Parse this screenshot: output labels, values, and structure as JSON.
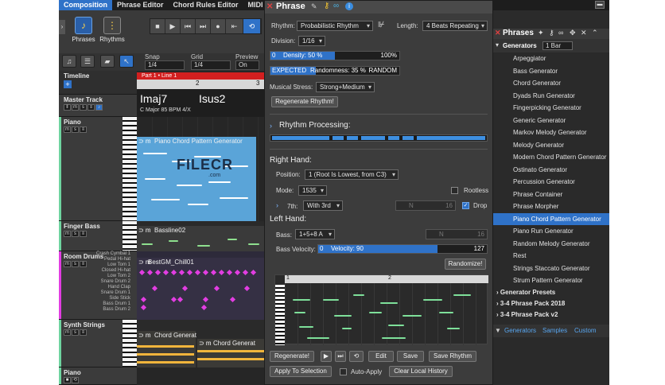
{
  "menubar": {
    "tabs": [
      "Composition",
      "Phrase Editor",
      "Chord Rules Editor",
      "MIDI Import"
    ]
  },
  "toolbar": {
    "phrases_label": "Phrases",
    "rhythms_label": "Rhythms"
  },
  "snaprow": {
    "snap_label": "Snap",
    "snap_value": "1/4",
    "grid_label": "Grid",
    "grid_value": "1/4",
    "preview_label": "Preview",
    "preview_value": "On"
  },
  "timeline": {
    "label": "Timeline",
    "marker": "Part 1 • Line 1",
    "bar2": "2",
    "bar3": "3"
  },
  "chords": {
    "c1": "Imaj7",
    "c2": "Isus2",
    "key_info": "C Major   85 BPM   4/X"
  },
  "tracks": {
    "master": "Master Track",
    "piano": "Piano",
    "finger_bass": "Finger Bass",
    "room_drums": "Room Drums",
    "synth_strings": "Synth Strings",
    "piano2": "Piano"
  },
  "drum_rows": [
    "Crash Cymbal 1",
    "Pedal Hi-hat",
    "Low Tom 1",
    "Closed Hi-hat",
    "Low Tom 2",
    "Snare Drum 2",
    "Hand Clap",
    "Snare Drum 1",
    "Side Stick",
    "Bass Drum 1",
    "Bass Drum 2"
  ],
  "clips": {
    "piano": "Piano Chord Pattern Generator",
    "bass": "Bassline02",
    "drums": "BestGM_Chill01",
    "strings1": "Chord Generat",
    "strings2": "Chord Generat"
  },
  "watermark": {
    "text": "FILECR",
    "sub": ".com"
  },
  "phrase": {
    "title": "Phrase",
    "rhythm_label": "Rhythm:",
    "rhythm_value": "Probabilistic Rhythm",
    "length_label": "Length:",
    "length_value": "4 Beats Repeating",
    "division_label": "Division:",
    "division_value": "1/16",
    "density_min": "0",
    "density_text": "Density: 50 %",
    "density_max": "100%",
    "density_value": 50,
    "expected_label": "EXPECTED",
    "randomness_text": "Randomness: 35 %",
    "random_label": "RANDOM",
    "randomness_value": 35,
    "stress_label": "Musical Stress:",
    "stress_value": "Strong+Medium",
    "regen_rhythm": "Regenerate Rhythm!",
    "rhythm_processing": "Rhythm Processing:",
    "right_hand": "Right Hand:",
    "position_label": "Position:",
    "position_value": "1 (Root Is Lowest, from C3)",
    "mode_label": "Mode:",
    "mode_value": "1535",
    "rootless_label": "Rootless",
    "seventh_label": "7th:",
    "seventh_value": "With 3rd",
    "n_label": "N",
    "n_value": "16",
    "drop_label": "Drop",
    "left_hand": "Left Hand:",
    "bass_label": "Bass:",
    "bass_value": "1+5+8 A",
    "bass_n_label": "N",
    "bass_n_value": "16",
    "velocity_label": "Bass Velocity:",
    "velocity_min": "0",
    "velocity_text": "Velocity: 90",
    "velocity_max": "127",
    "velocity_value": 90,
    "randomize": "Randomize!",
    "roll_bar1": "1",
    "roll_bar2": "2",
    "regenerate": "Regenerate!",
    "edit": "Edit",
    "save": "Save",
    "save_rhythm": "Save Rhythm",
    "apply_selection": "Apply To Selection",
    "auto_apply": "Auto-Apply",
    "clear_history": "Clear Local History"
  },
  "panel": {
    "title": "Phrases",
    "generators_label": "Generators",
    "bar_value": "1 Bar",
    "items": [
      "Arpeggiator",
      "Bass Generator",
      "Chord Generator",
      "Dyads Run Generator",
      "Fingerpicking Generator",
      "Generic Generator",
      "Markov Melody Generator",
      "Melody Generator",
      "Modern Chord Pattern Generator",
      "Ostinato Generator",
      "Percussion Generator",
      "Phrase Container",
      "Phrase Morpher",
      "Piano Chord Pattern Generator",
      "Piano Run Generator",
      "Random Melody Generator",
      "Rest",
      "Strings Staccato Generator",
      "Strum Pattern Generator"
    ],
    "selected_index": 13,
    "groups": [
      "Generator Presets",
      "3-4 Phrase Pack 2018",
      "3-4 Phrase Pack v2"
    ],
    "tabs": [
      "Generators",
      "Samples",
      "Custom"
    ]
  },
  "colors": {
    "accent": "#2f72c8",
    "piano_clip": "#5aa4d8",
    "drum_dot": "#e23de2",
    "strings_clip": "#f1b53c",
    "roll_note": "#7ee09a"
  }
}
